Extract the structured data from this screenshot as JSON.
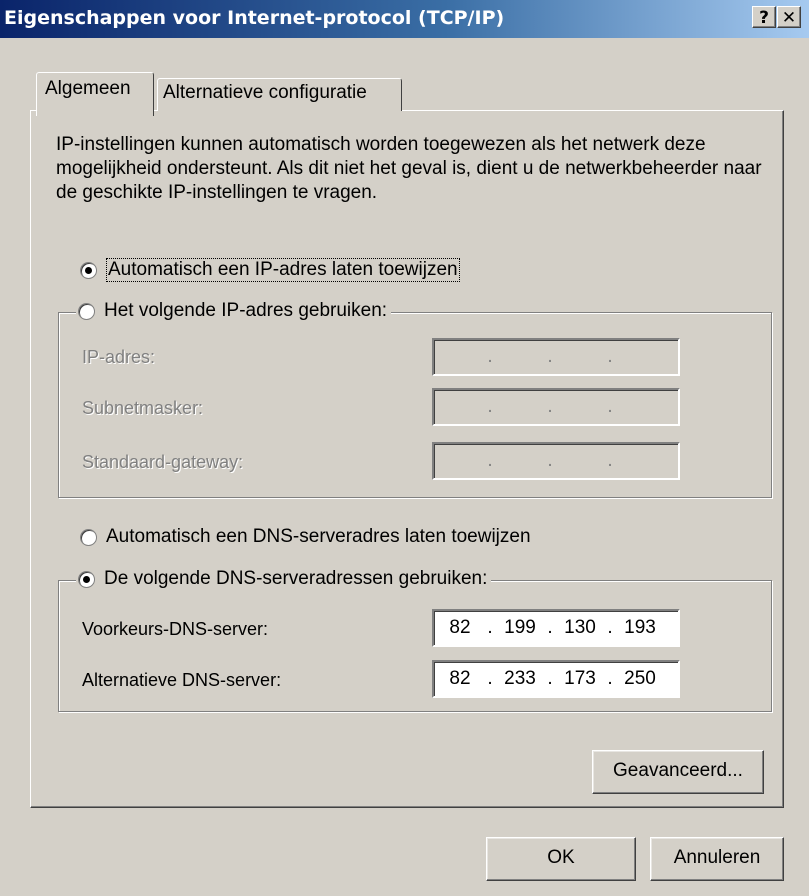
{
  "window": {
    "title": "Eigenschappen voor Internet-protocol (TCP/IP)",
    "help_label": "?",
    "close_label": "✕"
  },
  "tabs": [
    {
      "label": "Algemeen",
      "active": true
    },
    {
      "label": "Alternatieve configuratie",
      "active": false
    }
  ],
  "intro_text": "IP-instellingen kunnen automatisch worden toegewezen als het netwerk deze mogelijkheid ondersteunt. Als dit niet het geval is, dient u de netwerkbeheerder naar de geschikte IP-instellingen te vragen.",
  "ip_mode": {
    "auto_label": "Automatisch een IP-adres laten toewijzen",
    "auto_selected": true,
    "manual_label": "Het volgende IP-adres gebruiken:",
    "manual_selected": false
  },
  "ip_fields": [
    {
      "label": "IP-adres:",
      "octets": [
        "",
        "",
        "",
        ""
      ],
      "enabled": false
    },
    {
      "label": "Subnetmasker:",
      "octets": [
        "",
        "",
        "",
        ""
      ],
      "enabled": false
    },
    {
      "label": "Standaard-gateway:",
      "octets": [
        "",
        "",
        "",
        ""
      ],
      "enabled": false
    }
  ],
  "dns_mode": {
    "auto_label": "Automatisch een DNS-serveradres laten toewijzen",
    "auto_selected": false,
    "manual_label": "De volgende DNS-serveradressen gebruiken:",
    "manual_selected": true
  },
  "dns_fields": [
    {
      "label": "Voorkeurs-DNS-server:",
      "octets": [
        "82",
        "199",
        "130",
        "193"
      ],
      "enabled": true
    },
    {
      "label": "Alternatieve DNS-server:",
      "octets": [
        "82",
        "233",
        "173",
        "250"
      ],
      "enabled": true
    }
  ],
  "buttons": {
    "advanced": "Geavanceerd...",
    "ok": "OK",
    "cancel": "Annuleren"
  },
  "colors": {
    "titlebar_start": "#0a246a",
    "titlebar_end": "#a6caf0",
    "face": "#d4d0c8"
  }
}
